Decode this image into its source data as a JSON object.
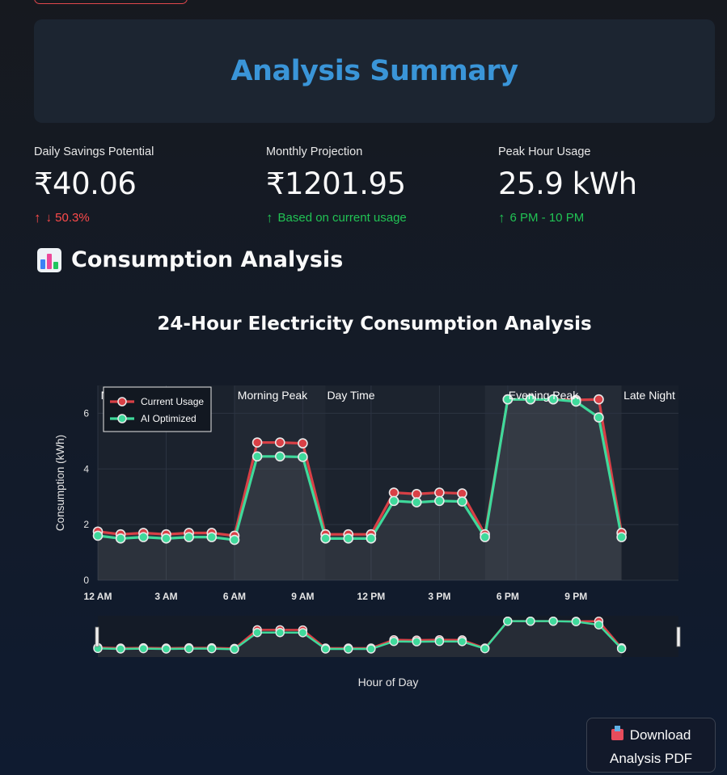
{
  "summary": {
    "title": "Analysis Summary"
  },
  "metrics": [
    {
      "label": "Daily Savings Potential",
      "value": "₹40.06",
      "delta": "↓ 50.3%",
      "arrow": "↑",
      "tone": "red"
    },
    {
      "label": "Monthly Projection",
      "value": "₹1201.95",
      "delta": "Based on current usage",
      "arrow": "↑",
      "tone": "green"
    },
    {
      "label": "Peak Hour Usage",
      "value": "25.9 kWh",
      "delta": "6 PM - 10 PM",
      "arrow": "↑",
      "tone": "green"
    }
  ],
  "section": {
    "title": "Consumption Analysis",
    "icon": "bar-chart-icon"
  },
  "download": {
    "line1": "Download",
    "line2": "Analysis PDF",
    "icon": "inbox-tray-icon"
  },
  "colors": {
    "current": "#d94046",
    "optimized": "#3fd99b",
    "title_blue": "#3a95d8"
  },
  "chart_data": {
    "type": "line",
    "title": "24-Hour Electricity Consumption Analysis",
    "xlabel": "Hour of Day",
    "ylabel": "Consumption (kWh)",
    "x": [
      0,
      1,
      2,
      3,
      4,
      5,
      6,
      7,
      8,
      9,
      10,
      11,
      12,
      13,
      14,
      15,
      16,
      17,
      18,
      19,
      20,
      21,
      22,
      23
    ],
    "xlim": [
      0,
      25.5
    ],
    "ylim": [
      0,
      7
    ],
    "yticks": [
      0,
      2,
      4,
      6
    ],
    "xticks": [
      {
        "v": 0,
        "label": "12 AM"
      },
      {
        "v": 3,
        "label": "3 AM"
      },
      {
        "v": 6,
        "label": "6 AM"
      },
      {
        "v": 9,
        "label": "9 AM"
      },
      {
        "v": 12,
        "label": "12 PM"
      },
      {
        "v": 15,
        "label": "3 PM"
      },
      {
        "v": 18,
        "label": "6 PM"
      },
      {
        "v": 21,
        "label": "9 PM"
      }
    ],
    "series": [
      {
        "name": "Current Usage",
        "color": "#d94046",
        "values": [
          1.75,
          1.65,
          1.7,
          1.65,
          1.7,
          1.7,
          1.6,
          4.95,
          4.95,
          4.92,
          1.65,
          1.65,
          1.65,
          3.15,
          3.1,
          3.15,
          3.12,
          1.65,
          6.5,
          6.5,
          6.5,
          6.48,
          6.5,
          1.7
        ]
      },
      {
        "name": "AI Optimized",
        "color": "#3fd99b",
        "values": [
          1.6,
          1.5,
          1.55,
          1.5,
          1.55,
          1.55,
          1.45,
          4.45,
          4.45,
          4.43,
          1.5,
          1.5,
          1.5,
          2.85,
          2.8,
          2.85,
          2.83,
          1.55,
          6.5,
          6.5,
          6.5,
          6.42,
          5.85,
          1.55
        ]
      }
    ],
    "periods": [
      {
        "label": "Night",
        "from": 0,
        "to": 6
      },
      {
        "label": "Morning Peak",
        "from": 6,
        "to": 10
      },
      {
        "label": "Day Time",
        "from": 10,
        "to": 17
      },
      {
        "label": "Evening Peak",
        "from": 17,
        "to": 23
      },
      {
        "label": "Late Night",
        "from": 23,
        "to": 25.5
      }
    ],
    "legend_position": "top-left",
    "grid": true,
    "range_slider": true
  }
}
